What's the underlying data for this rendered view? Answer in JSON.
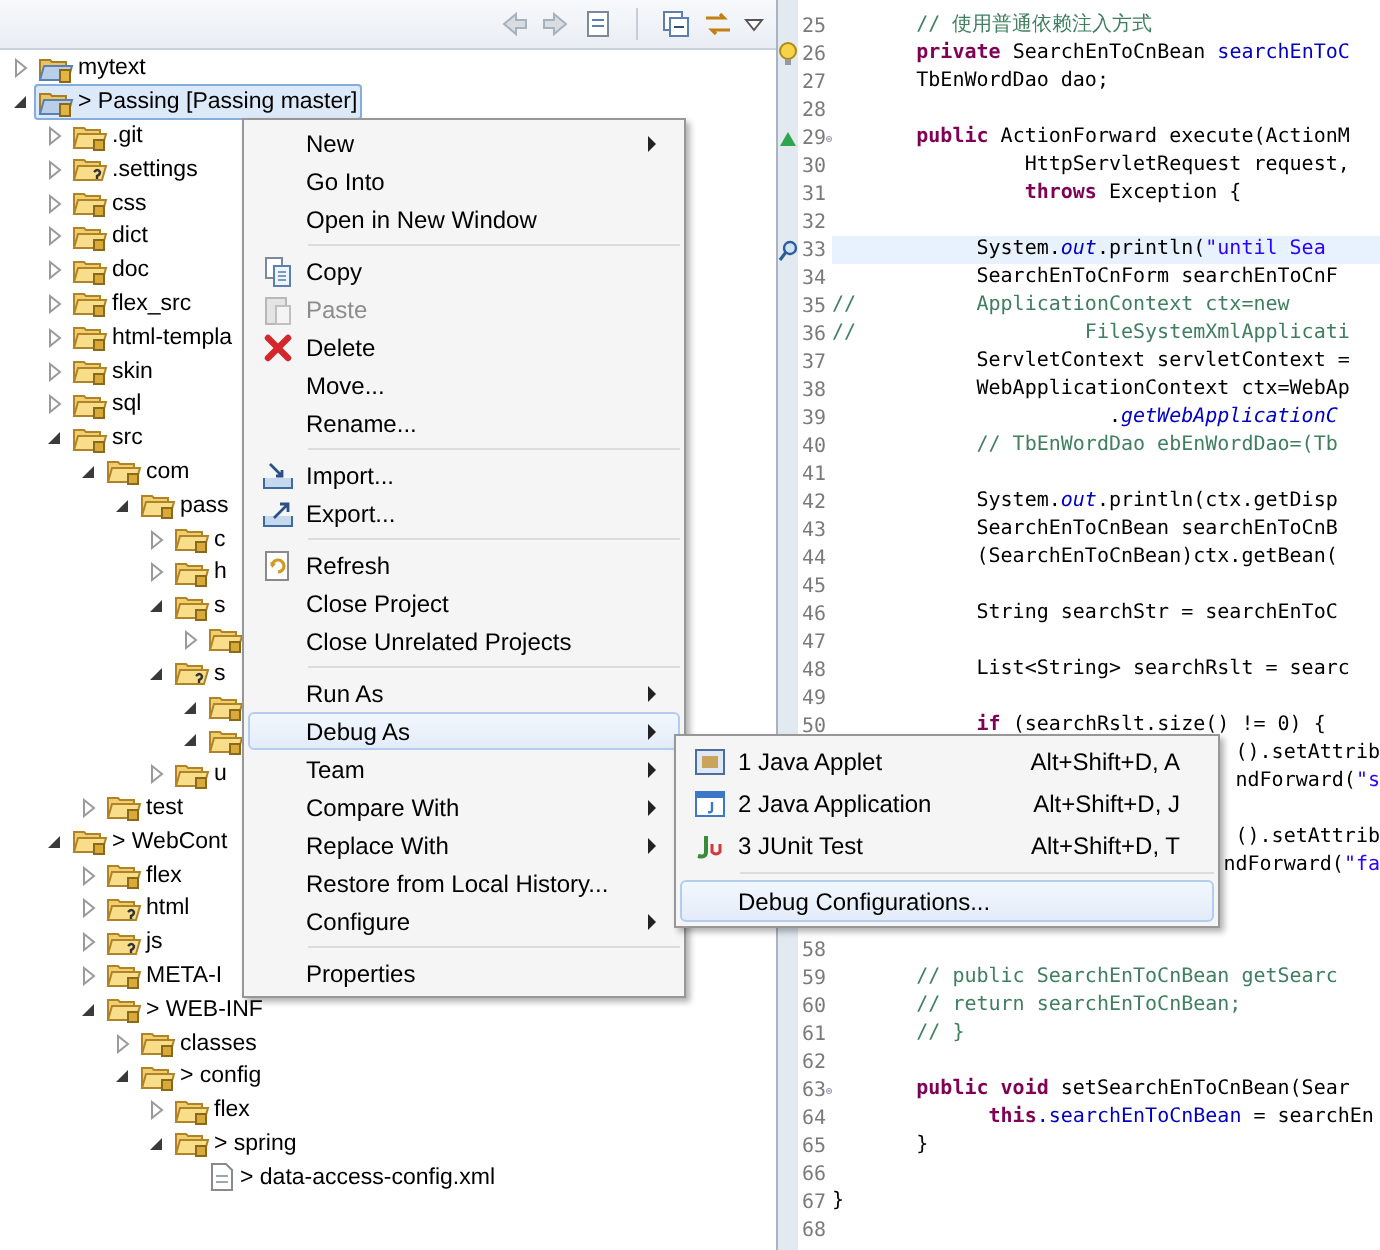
{
  "tree": [
    {
      "label": "mytext",
      "kind": "project",
      "expanded": false,
      "selected": false
    },
    {
      "label": "> Passing [Passing master]",
      "kind": "project",
      "expanded": true,
      "selected": true,
      "children": [
        {
          "label": ".git",
          "kind": "folder",
          "expanded": false,
          "selected": false
        },
        {
          "label": ".settings",
          "kind": "folder-untracked",
          "expanded": false,
          "selected": false
        },
        {
          "label": "css",
          "kind": "folder",
          "expanded": false,
          "selected": false
        },
        {
          "label": "dict",
          "kind": "folder",
          "expanded": false,
          "selected": false
        },
        {
          "label": "doc",
          "kind": "folder",
          "expanded": false,
          "selected": false
        },
        {
          "label": "flex_src",
          "kind": "folder",
          "expanded": false,
          "selected": false
        },
        {
          "label": "html-templa",
          "kind": "folder",
          "expanded": false,
          "selected": false
        },
        {
          "label": "skin",
          "kind": "folder",
          "expanded": false,
          "selected": false
        },
        {
          "label": "sql",
          "kind": "folder",
          "expanded": false,
          "selected": false
        },
        {
          "label": "src",
          "kind": "folder",
          "expanded": true,
          "selected": false,
          "children": [
            {
              "label": "com",
              "kind": "folder",
              "expanded": true,
              "selected": false,
              "children": [
                {
                  "label": "pass",
                  "kind": "folder",
                  "expanded": true,
                  "selected": false,
                  "children": [
                    {
                      "label": "c",
                      "kind": "folder",
                      "expanded": false,
                      "selected": false
                    },
                    {
                      "label": "h",
                      "kind": "folder",
                      "expanded": false,
                      "selected": false
                    },
                    {
                      "label": "s",
                      "kind": "folder",
                      "expanded": true,
                      "selected": false,
                      "children": [
                        {
                          "kind": "folder",
                          "expanded": false,
                          "selected": false
                        }
                      ]
                    },
                    {
                      "label": "s",
                      "kind": "folder-untracked",
                      "expanded": true,
                      "selected": false,
                      "children": [
                        {
                          "kind": "folder",
                          "expanded": true,
                          "selected": false
                        },
                        {
                          "kind": "folder",
                          "expanded": true,
                          "selected": false
                        }
                      ]
                    },
                    {
                      "label": "u",
                      "kind": "folder",
                      "expanded": false,
                      "selected": false
                    }
                  ]
                }
              ]
            },
            {
              "label": "test",
              "kind": "folder",
              "expanded": false,
              "selected": false
            }
          ]
        },
        {
          "label": "> WebCont",
          "kind": "folder",
          "expanded": true,
          "selected": false,
          "children": [
            {
              "label": "flex",
              "kind": "folder",
              "expanded": false,
              "selected": false
            },
            {
              "label": "html",
              "kind": "folder-untracked",
              "expanded": false,
              "selected": false
            },
            {
              "label": "js",
              "kind": "folder-untracked",
              "expanded": false,
              "selected": false
            },
            {
              "label": "META-I",
              "kind": "folder",
              "expanded": false,
              "selected": false
            },
            {
              "label": "> WEB-INF",
              "kind": "folder",
              "expanded": true,
              "selected": false,
              "children": [
                {
                  "label": "classes",
                  "kind": "folder",
                  "expanded": false,
                  "selected": false
                },
                {
                  "label": "> config",
                  "kind": "folder",
                  "expanded": true,
                  "selected": false,
                  "children": [
                    {
                      "label": "flex",
                      "kind": "folder",
                      "expanded": false,
                      "selected": false
                    },
                    {
                      "label": "> spring",
                      "kind": "folder",
                      "expanded": true,
                      "selected": false,
                      "children": [
                        {
                          "label": "> data-access-config.xml",
                          "kind": "file",
                          "selected": false
                        }
                      ]
                    }
                  ]
                }
              ]
            }
          ]
        }
      ]
    }
  ],
  "code_lines": [
    {
      "kind": "line",
      "number": "25",
      "highlighted": false,
      "parts": [
        {
          "text": "       // 使用普通依赖注入方式",
          "kind": "comment"
        }
      ]
    },
    {
      "kind": "warning-line",
      "number": "26",
      "highlighted": false,
      "parts": [
        {
          "text": "       private",
          "kind": "keyword"
        },
        {
          "text": " SearchEnToCnBean ",
          "kind": "plain"
        },
        {
          "text": "searchEnToC",
          "kind": "field"
        }
      ]
    },
    {
      "kind": "line",
      "number": "27",
      "highlighted": false,
      "parts": [
        {
          "text": "       TbEnWordDao dao;",
          "kind": "plain"
        }
      ]
    },
    {
      "kind": "line",
      "number": "28",
      "highlighted": false
    },
    {
      "kind": "override-line",
      "number": "29",
      "highlighted": false,
      "parts": [
        {
          "text": "       public",
          "kind": "keyword"
        },
        {
          "text": " ActionForward execute(ActionM",
          "kind": "plain"
        }
      ]
    },
    {
      "kind": "line",
      "number": "30",
      "highlighted": false,
      "parts": [
        {
          "text": "                HttpServletRequest request,",
          "kind": "plain"
        }
      ]
    },
    {
      "kind": "line",
      "number": "31",
      "highlighted": false,
      "parts": [
        {
          "text": "                throws",
          "kind": "keyword"
        },
        {
          "text": " Exception {",
          "kind": "plain"
        }
      ]
    },
    {
      "kind": "line",
      "number": "32",
      "highlighted": false
    },
    {
      "kind": "search-line",
      "number": "33",
      "highlighted": true,
      "parts": [
        {
          "text": "            System.",
          "kind": "plain"
        },
        {
          "text": "out",
          "kind": "static"
        },
        {
          "text": ".println(",
          "kind": "plain"
        },
        {
          "text": "\"until Sea",
          "kind": "string"
        }
      ]
    },
    {
      "kind": "line",
      "number": "34",
      "highlighted": false,
      "parts": [
        {
          "text": "            SearchEnToCnForm searchEnToCnF",
          "kind": "plain"
        }
      ]
    },
    {
      "kind": "line",
      "number": "35",
      "highlighted": false,
      "parts": [
        {
          "text": "//          ApplicationContext ctx=new",
          "kind": "comment"
        }
      ]
    },
    {
      "kind": "line",
      "number": "36",
      "highlighted": false,
      "parts": [
        {
          "text": "//                   FileSystemXmlApplicati",
          "kind": "comment"
        }
      ]
    },
    {
      "kind": "line",
      "number": "37",
      "highlighted": false,
      "parts": [
        {
          "text": "            ServletContext servletContext =",
          "kind": "plain"
        }
      ]
    },
    {
      "kind": "line",
      "number": "38",
      "highlighted": false,
      "parts": [
        {
          "text": "            WebApplicationContext ctx=WebAp",
          "kind": "plain"
        }
      ]
    },
    {
      "kind": "line",
      "number": "39",
      "highlighted": false,
      "parts": [
        {
          "text": "                       .",
          "kind": "plain"
        },
        {
          "text": "getWebApplicationC",
          "kind": "static"
        }
      ]
    },
    {
      "kind": "line",
      "number": "40",
      "highlighted": false,
      "parts": [
        {
          "text": "            // TbEnWordDao ebEnWordDao=(Tb",
          "kind": "comment"
        }
      ]
    },
    {
      "kind": "line",
      "number": "41",
      "highlighted": false
    },
    {
      "kind": "line",
      "number": "42",
      "highlighted": false,
      "parts": [
        {
          "text": "            System.",
          "kind": "plain"
        },
        {
          "text": "out",
          "kind": "static"
        },
        {
          "text": ".println(ctx.getDisp",
          "kind": "plain"
        }
      ]
    },
    {
      "kind": "line",
      "number": "43",
      "highlighted": false,
      "parts": [
        {
          "text": "            SearchEnToCnBean searchEnToCnB",
          "kind": "plain"
        }
      ]
    },
    {
      "kind": "line",
      "number": "44",
      "highlighted": false,
      "parts": [
        {
          "text": "            (SearchEnToCnBean)ctx.getBean(",
          "kind": "plain"
        }
      ]
    },
    {
      "kind": "line",
      "number": "45",
      "highlighted": false
    },
    {
      "kind": "line",
      "number": "46",
      "highlighted": false,
      "parts": [
        {
          "text": "            String searchStr = searchEnToC",
          "kind": "plain"
        }
      ]
    },
    {
      "kind": "line",
      "number": "47",
      "highlighted": false
    },
    {
      "kind": "line",
      "number": "48",
      "highlighted": false,
      "parts": [
        {
          "text": "            List<String> searchRslt = searc",
          "kind": "plain"
        }
      ]
    },
    {
      "kind": "line",
      "number": "49",
      "highlighted": false
    },
    {
      "kind": "line",
      "number": "50",
      "highlighted": false,
      "parts": [
        {
          "text": "            if",
          "kind": "keyword"
        },
        {
          "text": " (searchRslt.size() != 0) {",
          "kind": "plain"
        }
      ]
    },
    {
      "kind": "tail",
      "highlighted": false,
      "parts": [
        {
          "text": "().setAttrib",
          "kind": "plain"
        }
      ]
    },
    {
      "kind": "tail",
      "highlighted": false,
      "parts": [
        {
          "text": "ndForward(",
          "kind": "plain"
        },
        {
          "text": "\"s",
          "kind": "string"
        }
      ]
    },
    {
      "kind": "tail",
      "highlighted": false
    },
    {
      "kind": "tail",
      "highlighted": false,
      "parts": [
        {
          "text": "().setAttrib",
          "kind": "plain"
        }
      ]
    },
    {
      "kind": "tail",
      "highlighted": false,
      "parts": [
        {
          "text": "ndForward(",
          "kind": "plain"
        },
        {
          "text": "\"fa",
          "kind": "string"
        }
      ]
    },
    {
      "kind": "tail",
      "highlighted": false
    },
    {
      "kind": "tail",
      "highlighted": false
    },
    {
      "kind": "line",
      "number": "58",
      "highlighted": false
    },
    {
      "kind": "line",
      "number": "59",
      "highlighted": false,
      "parts": [
        {
          "text": "       // public SearchEnToCnBean getSearc",
          "kind": "comment"
        }
      ]
    },
    {
      "kind": "line",
      "number": "60",
      "highlighted": false,
      "parts": [
        {
          "text": "       // return searchEnToCnBean;",
          "kind": "comment"
        }
      ]
    },
    {
      "kind": "line",
      "number": "61",
      "highlighted": false,
      "parts": [
        {
          "text": "       // }",
          "kind": "comment"
        }
      ]
    },
    {
      "kind": "line",
      "number": "62",
      "highlighted": false
    },
    {
      "kind": "fold-line",
      "number": "63",
      "highlighted": false,
      "parts": [
        {
          "text": "       public void",
          "kind": "keyword"
        },
        {
          "text": " setSearchEnToCnBean(Sear",
          "kind": "plain"
        }
      ]
    },
    {
      "kind": "line",
      "number": "64",
      "highlighted": false,
      "parts": [
        {
          "text": "             this",
          "kind": "keyword"
        },
        {
          "text": ".searchEnToCnBean",
          "kind": "field"
        },
        {
          "text": " = searchEn",
          "kind": "plain"
        }
      ]
    },
    {
      "kind": "line",
      "number": "65",
      "highlighted": false,
      "parts": [
        {
          "text": "       }",
          "kind": "plain"
        }
      ]
    },
    {
      "kind": "line",
      "number": "66",
      "highlighted": false
    },
    {
      "kind": "line",
      "number": "67",
      "highlighted": false,
      "parts": [
        {
          "text": "}",
          "kind": "plain"
        }
      ]
    },
    {
      "kind": "line",
      "number": "68",
      "highlighted": false
    }
  ],
  "context_menu": [
    {
      "kind": "item",
      "label": "New",
      "submenu": true,
      "selected": false,
      "disabled": false
    },
    {
      "kind": "item",
      "label": "Go Into",
      "submenu": false,
      "selected": false,
      "disabled": false
    },
    {
      "kind": "item",
      "label": "Open in New Window",
      "submenu": false,
      "selected": false,
      "disabled": false
    },
    {
      "kind": "separator"
    },
    {
      "kind": "copy",
      "label": "Copy",
      "submenu": false,
      "selected": false,
      "disabled": false
    },
    {
      "kind": "paste",
      "label": "Paste",
      "submenu": false,
      "selected": false,
      "disabled": true
    },
    {
      "kind": "delete",
      "label": "Delete",
      "submenu": false,
      "selected": false,
      "disabled": false
    },
    {
      "kind": "item",
      "label": "Move...",
      "submenu": false,
      "selected": false,
      "disabled": false
    },
    {
      "kind": "item",
      "label": "Rename...",
      "submenu": false,
      "selected": false,
      "disabled": false
    },
    {
      "kind": "separator"
    },
    {
      "kind": "import",
      "label": "Import...",
      "submenu": false,
      "selected": false,
      "disabled": false
    },
    {
      "kind": "export",
      "label": "Export...",
      "submenu": false,
      "selected": false,
      "disabled": false
    },
    {
      "kind": "separator"
    },
    {
      "kind": "refresh",
      "label": "Refresh",
      "submenu": false,
      "selected": false,
      "disabled": false
    },
    {
      "kind": "item",
      "label": "Close Project",
      "submenu": false,
      "selected": false,
      "disabled": false
    },
    {
      "kind": "item",
      "label": "Close Unrelated Projects",
      "submenu": false,
      "selected": false,
      "disabled": false
    },
    {
      "kind": "separator"
    },
    {
      "kind": "item",
      "label": "Run As",
      "submenu": true,
      "selected": false,
      "disabled": false
    },
    {
      "kind": "item",
      "label": "Debug As",
      "submenu": true,
      "selected": true,
      "disabled": false
    },
    {
      "kind": "item",
      "label": "Team",
      "submenu": true,
      "selected": false,
      "disabled": false
    },
    {
      "kind": "item",
      "label": "Compare With",
      "submenu": true,
      "selected": false,
      "disabled": false
    },
    {
      "kind": "item",
      "label": "Replace With",
      "submenu": true,
      "selected": false,
      "disabled": false
    },
    {
      "kind": "item",
      "label": "Restore from Local History...",
      "submenu": false,
      "selected": false,
      "disabled": false
    },
    {
      "kind": "item",
      "label": "Configure",
      "submenu": true,
      "selected": false,
      "disabled": false
    },
    {
      "kind": "separator"
    },
    {
      "kind": "item",
      "label": "Properties",
      "submenu": false,
      "selected": false,
      "disabled": false
    }
  ],
  "debug_submenu": [
    {
      "kind": "applet",
      "label": "1 Java Applet",
      "shortcut": "Alt+Shift+D, A",
      "selected": false
    },
    {
      "kind": "application",
      "label": "2 Java Application",
      "shortcut": "Alt+Shift+D, J",
      "selected": false
    },
    {
      "kind": "junit",
      "label": "3 JUnit Test",
      "shortcut": "Alt+Shift+D, T",
      "selected": false
    },
    {
      "kind": "separator"
    },
    {
      "kind": "item",
      "label": "Debug Configurations...",
      "selected": true
    }
  ]
}
